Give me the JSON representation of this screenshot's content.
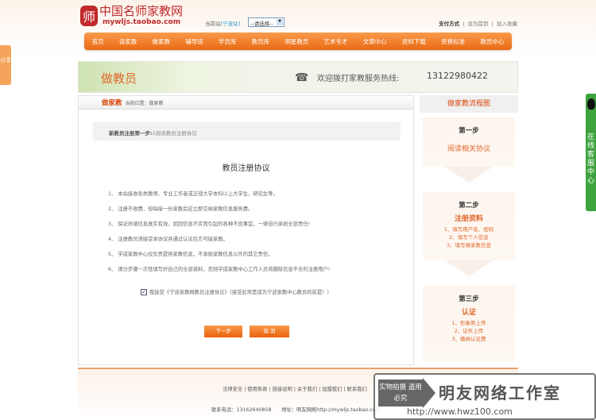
{
  "logo": {
    "cn": "中国名师家教网",
    "url": "mywljs.taobao.com",
    "seal": "师"
  },
  "site": {
    "label": "当前站",
    "city": "[宁波站]",
    "select": "--请选择--"
  },
  "toplinks": [
    "支付方式",
    "设为首页",
    "加入收藏"
  ],
  "nav": [
    "首页",
    "请家教",
    "做家教",
    "辅导班",
    "学员库",
    "教员库",
    "明星教员",
    "艺术专才",
    "文章中心",
    "资料下载",
    "资费标准",
    "教员中心"
  ],
  "banner": {
    "title": "做教员",
    "hotline_label": "欢迎拨打家教服务热线:",
    "hotline": "13122980422"
  },
  "main": {
    "section": "做家教",
    "breadcrumb": "当前位置：做家教",
    "step_label": "新教员注册第一步:",
    "step_text": "1阅读教员注册协议",
    "title": "教员注册协议",
    "terms": [
      "1、 本站接收各类教师、专业工作者或正规大学本科以上大学生、研究生等。",
      "2、 注册不收费，但每接一份家教后应立即交纳家教信息服务费。",
      "3、 保证所填信息真实有效，如因信息不实而引起的各种不良事宜，一律自行承担全部责任!",
      "4、 注册教员须接受本协议并通过认证后方可接家教。",
      "5、 学成家教中心仅负责提供家教信息，不承担家教信息以外的其它责任。",
      "6、 请分步骤一次性填写好自己的全部资料，否则学成家教中心工作人员将删除信息不全的注册用户!"
    ],
    "agree": "我接受《宁波家教网教员注册协议》（接受此项是成为宁波家教中心教员的前提！）",
    "agree_checked": true,
    "next": "下一步",
    "cancel": "取 消"
  },
  "side": {
    "title": "做家教流程图",
    "steps": [
      {
        "step": "第一步",
        "name": "阅读相关协议",
        "items": []
      },
      {
        "step": "第二步",
        "name": "注册资料",
        "items": [
          "1、填写用户名、密码",
          "2、填写个人信息",
          "3、填写做家教信息"
        ]
      },
      {
        "step": "第三步",
        "name": "认证",
        "items": [
          "1、形象照上传",
          "2、证件上传",
          "3、缴纳认证费"
        ]
      }
    ]
  },
  "footer": {
    "links": "法律安全 | 使用条款 | 链接说明 | 关于我们 | 加盟我们 | 联系我们",
    "contact": "联系电话：13162640858　　地址：明友网络http://mywljs.taobao.com"
  },
  "watermark": {
    "tag": "实物拍摄 盗用必究",
    "name": "明友网络工作室",
    "url": "http://www.hwz100.com"
  },
  "share": "分享",
  "service": "在线客服中心"
}
